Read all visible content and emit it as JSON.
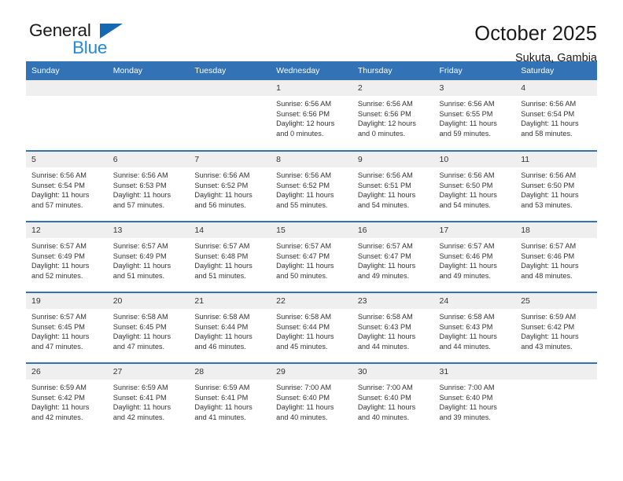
{
  "brand": {
    "name_part1": "General",
    "name_part2": "Blue",
    "accent_color": "#2389d8",
    "triangle_color": "#1668b3"
  },
  "header": {
    "title": "October 2025",
    "subtitle": "Sukuta, Gambia"
  },
  "calendar": {
    "header_bg": "#3272b5",
    "daynum_bg": "#efefef",
    "weekday_headers": [
      "Sunday",
      "Monday",
      "Tuesday",
      "Wednesday",
      "Thursday",
      "Friday",
      "Saturday"
    ],
    "weeks": [
      [
        {
          "day": "",
          "sunrise": "",
          "sunset": "",
          "daylight_line1": "",
          "daylight_line2": ""
        },
        {
          "day": "",
          "sunrise": "",
          "sunset": "",
          "daylight_line1": "",
          "daylight_line2": ""
        },
        {
          "day": "",
          "sunrise": "",
          "sunset": "",
          "daylight_line1": "",
          "daylight_line2": ""
        },
        {
          "day": "1",
          "sunrise": "Sunrise: 6:56 AM",
          "sunset": "Sunset: 6:56 PM",
          "daylight_line1": "Daylight: 12 hours",
          "daylight_line2": "and 0 minutes."
        },
        {
          "day": "2",
          "sunrise": "Sunrise: 6:56 AM",
          "sunset": "Sunset: 6:56 PM",
          "daylight_line1": "Daylight: 12 hours",
          "daylight_line2": "and 0 minutes."
        },
        {
          "day": "3",
          "sunrise": "Sunrise: 6:56 AM",
          "sunset": "Sunset: 6:55 PM",
          "daylight_line1": "Daylight: 11 hours",
          "daylight_line2": "and 59 minutes."
        },
        {
          "day": "4",
          "sunrise": "Sunrise: 6:56 AM",
          "sunset": "Sunset: 6:54 PM",
          "daylight_line1": "Daylight: 11 hours",
          "daylight_line2": "and 58 minutes."
        }
      ],
      [
        {
          "day": "5",
          "sunrise": "Sunrise: 6:56 AM",
          "sunset": "Sunset: 6:54 PM",
          "daylight_line1": "Daylight: 11 hours",
          "daylight_line2": "and 57 minutes."
        },
        {
          "day": "6",
          "sunrise": "Sunrise: 6:56 AM",
          "sunset": "Sunset: 6:53 PM",
          "daylight_line1": "Daylight: 11 hours",
          "daylight_line2": "and 57 minutes."
        },
        {
          "day": "7",
          "sunrise": "Sunrise: 6:56 AM",
          "sunset": "Sunset: 6:52 PM",
          "daylight_line1": "Daylight: 11 hours",
          "daylight_line2": "and 56 minutes."
        },
        {
          "day": "8",
          "sunrise": "Sunrise: 6:56 AM",
          "sunset": "Sunset: 6:52 PM",
          "daylight_line1": "Daylight: 11 hours",
          "daylight_line2": "and 55 minutes."
        },
        {
          "day": "9",
          "sunrise": "Sunrise: 6:56 AM",
          "sunset": "Sunset: 6:51 PM",
          "daylight_line1": "Daylight: 11 hours",
          "daylight_line2": "and 54 minutes."
        },
        {
          "day": "10",
          "sunrise": "Sunrise: 6:56 AM",
          "sunset": "Sunset: 6:50 PM",
          "daylight_line1": "Daylight: 11 hours",
          "daylight_line2": "and 54 minutes."
        },
        {
          "day": "11",
          "sunrise": "Sunrise: 6:56 AM",
          "sunset": "Sunset: 6:50 PM",
          "daylight_line1": "Daylight: 11 hours",
          "daylight_line2": "and 53 minutes."
        }
      ],
      [
        {
          "day": "12",
          "sunrise": "Sunrise: 6:57 AM",
          "sunset": "Sunset: 6:49 PM",
          "daylight_line1": "Daylight: 11 hours",
          "daylight_line2": "and 52 minutes."
        },
        {
          "day": "13",
          "sunrise": "Sunrise: 6:57 AM",
          "sunset": "Sunset: 6:49 PM",
          "daylight_line1": "Daylight: 11 hours",
          "daylight_line2": "and 51 minutes."
        },
        {
          "day": "14",
          "sunrise": "Sunrise: 6:57 AM",
          "sunset": "Sunset: 6:48 PM",
          "daylight_line1": "Daylight: 11 hours",
          "daylight_line2": "and 51 minutes."
        },
        {
          "day": "15",
          "sunrise": "Sunrise: 6:57 AM",
          "sunset": "Sunset: 6:47 PM",
          "daylight_line1": "Daylight: 11 hours",
          "daylight_line2": "and 50 minutes."
        },
        {
          "day": "16",
          "sunrise": "Sunrise: 6:57 AM",
          "sunset": "Sunset: 6:47 PM",
          "daylight_line1": "Daylight: 11 hours",
          "daylight_line2": "and 49 minutes."
        },
        {
          "day": "17",
          "sunrise": "Sunrise: 6:57 AM",
          "sunset": "Sunset: 6:46 PM",
          "daylight_line1": "Daylight: 11 hours",
          "daylight_line2": "and 49 minutes."
        },
        {
          "day": "18",
          "sunrise": "Sunrise: 6:57 AM",
          "sunset": "Sunset: 6:46 PM",
          "daylight_line1": "Daylight: 11 hours",
          "daylight_line2": "and 48 minutes."
        }
      ],
      [
        {
          "day": "19",
          "sunrise": "Sunrise: 6:57 AM",
          "sunset": "Sunset: 6:45 PM",
          "daylight_line1": "Daylight: 11 hours",
          "daylight_line2": "and 47 minutes."
        },
        {
          "day": "20",
          "sunrise": "Sunrise: 6:58 AM",
          "sunset": "Sunset: 6:45 PM",
          "daylight_line1": "Daylight: 11 hours",
          "daylight_line2": "and 47 minutes."
        },
        {
          "day": "21",
          "sunrise": "Sunrise: 6:58 AM",
          "sunset": "Sunset: 6:44 PM",
          "daylight_line1": "Daylight: 11 hours",
          "daylight_line2": "and 46 minutes."
        },
        {
          "day": "22",
          "sunrise": "Sunrise: 6:58 AM",
          "sunset": "Sunset: 6:44 PM",
          "daylight_line1": "Daylight: 11 hours",
          "daylight_line2": "and 45 minutes."
        },
        {
          "day": "23",
          "sunrise": "Sunrise: 6:58 AM",
          "sunset": "Sunset: 6:43 PM",
          "daylight_line1": "Daylight: 11 hours",
          "daylight_line2": "and 44 minutes."
        },
        {
          "day": "24",
          "sunrise": "Sunrise: 6:58 AM",
          "sunset": "Sunset: 6:43 PM",
          "daylight_line1": "Daylight: 11 hours",
          "daylight_line2": "and 44 minutes."
        },
        {
          "day": "25",
          "sunrise": "Sunrise: 6:59 AM",
          "sunset": "Sunset: 6:42 PM",
          "daylight_line1": "Daylight: 11 hours",
          "daylight_line2": "and 43 minutes."
        }
      ],
      [
        {
          "day": "26",
          "sunrise": "Sunrise: 6:59 AM",
          "sunset": "Sunset: 6:42 PM",
          "daylight_line1": "Daylight: 11 hours",
          "daylight_line2": "and 42 minutes."
        },
        {
          "day": "27",
          "sunrise": "Sunrise: 6:59 AM",
          "sunset": "Sunset: 6:41 PM",
          "daylight_line1": "Daylight: 11 hours",
          "daylight_line2": "and 42 minutes."
        },
        {
          "day": "28",
          "sunrise": "Sunrise: 6:59 AM",
          "sunset": "Sunset: 6:41 PM",
          "daylight_line1": "Daylight: 11 hours",
          "daylight_line2": "and 41 minutes."
        },
        {
          "day": "29",
          "sunrise": "Sunrise: 7:00 AM",
          "sunset": "Sunset: 6:40 PM",
          "daylight_line1": "Daylight: 11 hours",
          "daylight_line2": "and 40 minutes."
        },
        {
          "day": "30",
          "sunrise": "Sunrise: 7:00 AM",
          "sunset": "Sunset: 6:40 PM",
          "daylight_line1": "Daylight: 11 hours",
          "daylight_line2": "and 40 minutes."
        },
        {
          "day": "31",
          "sunrise": "Sunrise: 7:00 AM",
          "sunset": "Sunset: 6:40 PM",
          "daylight_line1": "Daylight: 11 hours",
          "daylight_line2": "and 39 minutes."
        },
        {
          "day": "",
          "sunrise": "",
          "sunset": "",
          "daylight_line1": "",
          "daylight_line2": ""
        }
      ]
    ]
  }
}
